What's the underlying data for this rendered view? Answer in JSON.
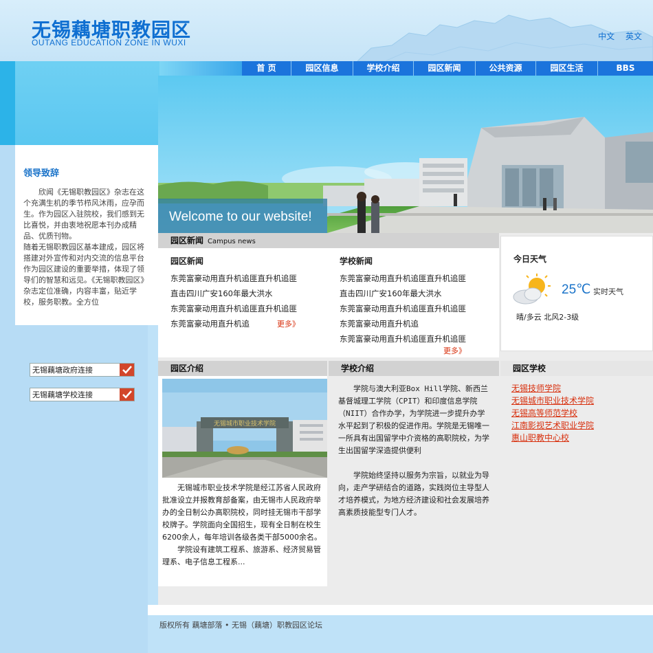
{
  "header": {
    "logo_cn": "无锡藕塘职教园区",
    "logo_en": "OUTANG  EDUCATION ZONE IN WUXI",
    "lang": [
      "中文",
      "英文"
    ]
  },
  "nav": [
    "首 页",
    "园区信息",
    "学校介绍",
    "园区新闻",
    "公共资源",
    "园区生活",
    "BBS"
  ],
  "welcome": {
    "title": "领导致辞",
    "p1": "欣闻《无锡职教园区》杂志在这个充满生机的季节栉风沐雨，应孕而生。作为园区入驻院校，我们感到无比喜悦，并由衷地祝愿本刊办成精品、优质刊物。",
    "p2": "随着无锡职教园区基本建成，园区将搭建对外宣传和对内交流的信息平台作为园区建设的重要举措，体现了领导们的智慧和远见。《无锡职教园区》杂志定位准确，内容丰富，贴近学校，服务职教。全方位"
  },
  "links": [
    "无锡藕塘政府连接",
    "无锡藕塘学校连接"
  ],
  "banner": {
    "welcome": "Welcome to our website!"
  },
  "news_section": {
    "title": "园区新闻",
    "subtitle": "Campus news"
  },
  "news_left": {
    "title": "园区新闻",
    "items": [
      "东莞富豪动用直升机追匪直升机追匪",
      "直击四川广安160年最大洪水",
      "东莞富豪动用直升机追匪直升机追匪",
      "东莞富豪动用直升机追"
    ],
    "more": "更多》"
  },
  "news_right": {
    "title": "学校新闻",
    "items": [
      "东莞富豪动用直升机追匪直升机追匪",
      "直击四川广安160年最大洪水",
      "东莞富豪动用直升机追匪直升机追匪",
      "东莞富豪动用直升机追",
      "东莞富豪动用直升机追匪直升机追匪"
    ],
    "more": "更多》"
  },
  "weather": {
    "title": "今日天气",
    "temp": "25℃",
    "label": "实时天气",
    "desc": "晴/多云  北风2-3级"
  },
  "intro": {
    "title": "园区介绍",
    "gate_sign": "无锡城市职业技术学院",
    "p1": "无锡城市职业技术学院是经江苏省人民政府批准设立并报教育部备案，由无锡市人民政府举办的全日制公办高职院校，同时挂无锡市干部学校牌子。学院面向全国招生，现有全日制在校生6200余人，每年培训各级各类干部5000余名。",
    "p2": "学院设有建筑工程系、旅游系、经济贸易管理系、电子信息工程系..."
  },
  "school": {
    "title": "学校介绍",
    "p1": "学院与澳大利亚Box Hill学院、新西兰基督城理工学院（CPIT）和印度信息学院（NIIT）合作办学，为学院进一步提升办学水平起到了积极的促进作用。学院是无锡唯一一所具有出国留学中介资格的高职院校，为学生出国留学深造提供便利",
    "p2": "学院始终坚持以服务为宗旨，以就业为导向，走产学研结合的道路，实践岗位主导型人才培养模式，为地方经济建设和社会发展培养高素质技能型专门人才。"
  },
  "park_schools": {
    "title": "园区学校",
    "items": [
      "无锡技师学院",
      "无锡城市职业技术学院",
      "无锡高等师范学校",
      "江南影视艺术职业学院",
      "惠山职教中心校"
    ]
  },
  "footer": "版权所有 藕塘部落 • 无锡（藕塘）职教园区论坛"
}
